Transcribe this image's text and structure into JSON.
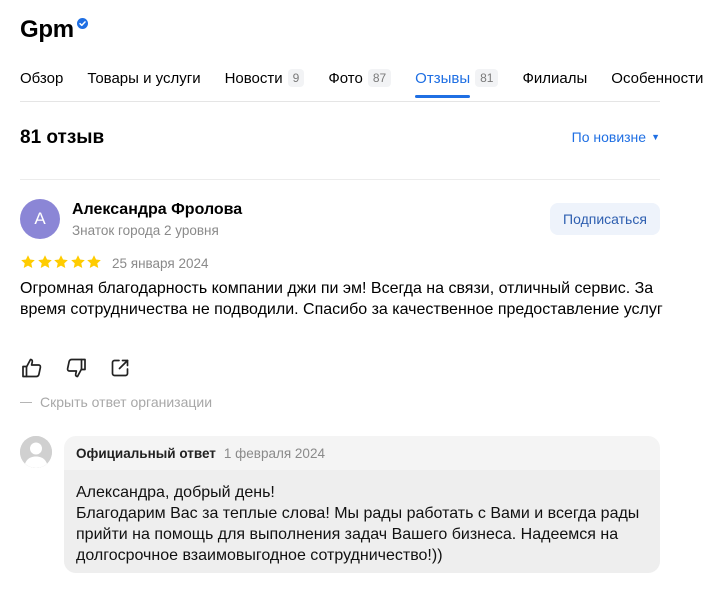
{
  "company": {
    "name": "Gpm",
    "verified_icon": "verified-badge-icon",
    "accent_color": "#1f6fe3"
  },
  "tabs": [
    {
      "label": "Обзор",
      "count": ""
    },
    {
      "label": "Товары и услуги",
      "count": ""
    },
    {
      "label": "Новости",
      "count": "9"
    },
    {
      "label": "Фото",
      "count": "87"
    },
    {
      "label": "Отзывы",
      "count": "81",
      "active": true
    },
    {
      "label": "Филиалы",
      "count": ""
    },
    {
      "label": "Особенности",
      "count": ""
    }
  ],
  "reviews_header": {
    "title": "81 отзыв",
    "sort_label": "По новизне"
  },
  "review": {
    "avatar_letter": "А",
    "avatar_color": "#8b86d6",
    "author": "Александра Фролова",
    "author_badge": "Знаток города 2 уровня",
    "subscribe_label": "Подписаться",
    "rating": 5,
    "date": "25 января 2024",
    "text": "Огромная благодарность компании джи пи эм! Всегда на связи, отличный сервис. За время сотрудничества не подводили. Спасибо за качественное предоставление услуг",
    "hide_reply_label": "Скрыть ответ организации",
    "actions": [
      "like-icon",
      "dislike-icon",
      "share-icon"
    ]
  },
  "org_reply": {
    "label": "Официальный ответ",
    "date": "1 февраля 2024",
    "lines": [
      "Александра, добрый день!",
      "Благодарим Вас за теплые слова! Мы рады работать с Вами и всегда рады",
      "прийти на помощь для выполнения задач Вашего бизнеса. Надеемся на",
      "долгосрочное взаимовыгодное сотрудничество!))"
    ]
  }
}
